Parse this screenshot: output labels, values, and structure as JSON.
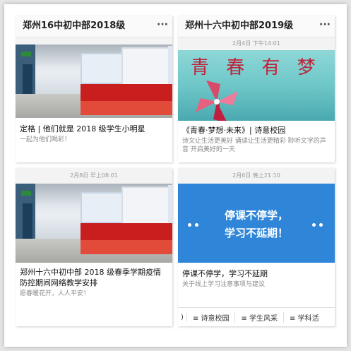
{
  "left": {
    "header_title": "郑州16中初中部2018级",
    "menu_icon": "more-dots-icon",
    "card1": {
      "timestamp": "",
      "title": "定格 | 他们就是 2018 级学生小明星",
      "subtitle": "一起为他们喝彩！"
    },
    "card2": {
      "timestamp": "2月8日 早上08:01",
      "title": "郑州十六中初中部 2018 级春季学期疫情防控期间网络教学安排",
      "subtitle": "愿春暖花开，人人平安！"
    }
  },
  "right": {
    "header_title": "郑州十六中初中部2019级",
    "menu_icon": "more-dots-icon",
    "card1": {
      "timestamp": "2月4日 下午14:01",
      "cover_text": "青 春 有 梦",
      "title": "《青春·梦想·未来》| 诗意校园",
      "subtitle": "诗文让生活更美好 诵读让生活更精彩 聆听文字的声音 开启美好的一天"
    },
    "card2": {
      "timestamp": "2月6日 晚上21:10",
      "cover_line1": "停课不停学，",
      "cover_line2": "学习不延期！",
      "title": "停课不停学，学习不延期",
      "subtitle": "关于线上学习注意事项与建议"
    },
    "bottom_menu": [
      "≡ 诗意校园",
      "≡ 学生风采",
      "≡ 学科活"
    ]
  }
}
